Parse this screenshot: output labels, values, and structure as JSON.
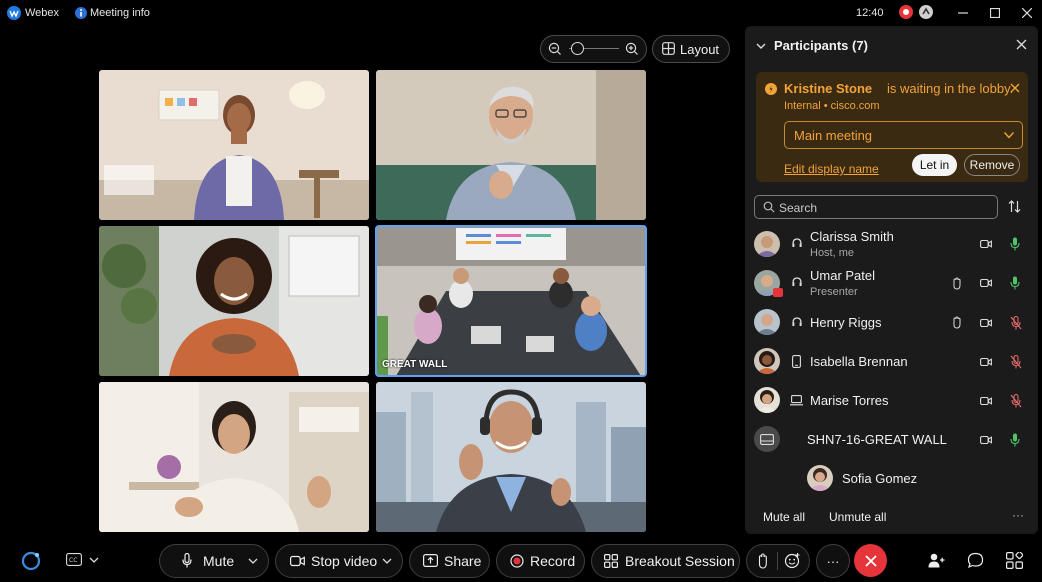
{
  "titlebar": {
    "app_name": "Webex",
    "meeting_info": "Meeting info",
    "time": "12:40"
  },
  "stage": {
    "layout_label": "Layout",
    "zoom_level": 0.1,
    "tile_label": "GREAT WALL"
  },
  "participants_panel": {
    "title": "Participants (7)",
    "lobby": {
      "name": "Kristine Stone",
      "message": "is waiting in the lobby.",
      "org": "Internal • cisco.com",
      "selected_meeting": "Main meeting",
      "edit_display_name": "Edit display name",
      "let_in": "Let in",
      "remove": "Remove"
    },
    "search_placeholder": "Search",
    "participants": [
      {
        "name": "Clarissa Smith",
        "role": "Host, me"
      },
      {
        "name": "Umar Patel",
        "role": "Presenter"
      },
      {
        "name": "Henry Riggs"
      },
      {
        "name": "Isabella Brennan"
      },
      {
        "name": "Marise Torres"
      },
      {
        "name": "SHN7-16-GREAT WALL"
      },
      {
        "name": "Sofia Gomez"
      }
    ],
    "mute_all": "Mute all",
    "unmute_all": "Unmute all",
    "more": "···"
  },
  "controls": {
    "mute": "Mute",
    "stop_video": "Stop video",
    "share": "Share",
    "record": "Record",
    "breakout": "Breakout Session",
    "more": "···"
  },
  "colors": {
    "accent_blue": "#5fa2f0",
    "end_call_red": "#e5343a",
    "mic_green": "#4dc36a",
    "muted_red": "#e06a6a",
    "lobby_orange": "#f2a33a"
  }
}
